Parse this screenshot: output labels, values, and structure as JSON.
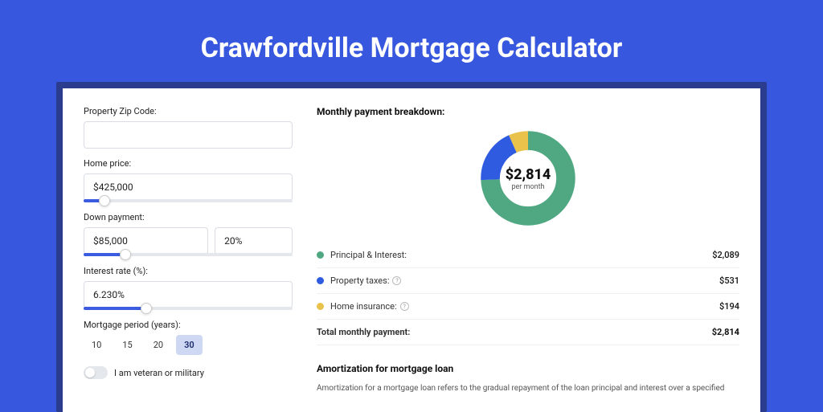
{
  "title": "Crawfordville Mortgage Calculator",
  "form": {
    "zip": {
      "label": "Property Zip Code:",
      "value": ""
    },
    "home_price": {
      "label": "Home price:",
      "value": "$425,000",
      "slider_pct": 10
    },
    "down_payment": {
      "label": "Down payment:",
      "value": "$85,000",
      "pct": "20%",
      "slider_pct": 20
    },
    "interest": {
      "label": "Interest rate (%):",
      "value": "6.230%",
      "slider_pct": 30
    },
    "period": {
      "label": "Mortgage period (years):",
      "options": [
        "10",
        "15",
        "20",
        "30"
      ],
      "active": "30"
    },
    "veteran": {
      "label": "I am veteran or military"
    }
  },
  "breakdown": {
    "title": "Monthly payment breakdown:",
    "amount": "$2,814",
    "per": "per month",
    "items": [
      {
        "color": "g",
        "label": "Principal & Interest:",
        "info": false,
        "value": "$2,089"
      },
      {
        "color": "b",
        "label": "Property taxes:",
        "info": true,
        "value": "$531"
      },
      {
        "color": "y",
        "label": "Home insurance:",
        "info": true,
        "value": "$194"
      }
    ],
    "total": {
      "label": "Total monthly payment:",
      "value": "$2,814"
    }
  },
  "amort": {
    "title": "Amortization for mortgage loan",
    "text": "Amortization for a mortgage loan refers to the gradual repayment of the loan principal and interest over a specified"
  },
  "chart_data": {
    "type": "pie",
    "title": "Monthly payment breakdown",
    "series": [
      {
        "name": "Principal & Interest",
        "value": 2089,
        "color": "#4fa882"
      },
      {
        "name": "Property taxes",
        "value": 531,
        "color": "#2f5be0"
      },
      {
        "name": "Home insurance",
        "value": 194,
        "color": "#e8c24b"
      }
    ],
    "total": 2814,
    "center_label": "$2,814 per month"
  }
}
